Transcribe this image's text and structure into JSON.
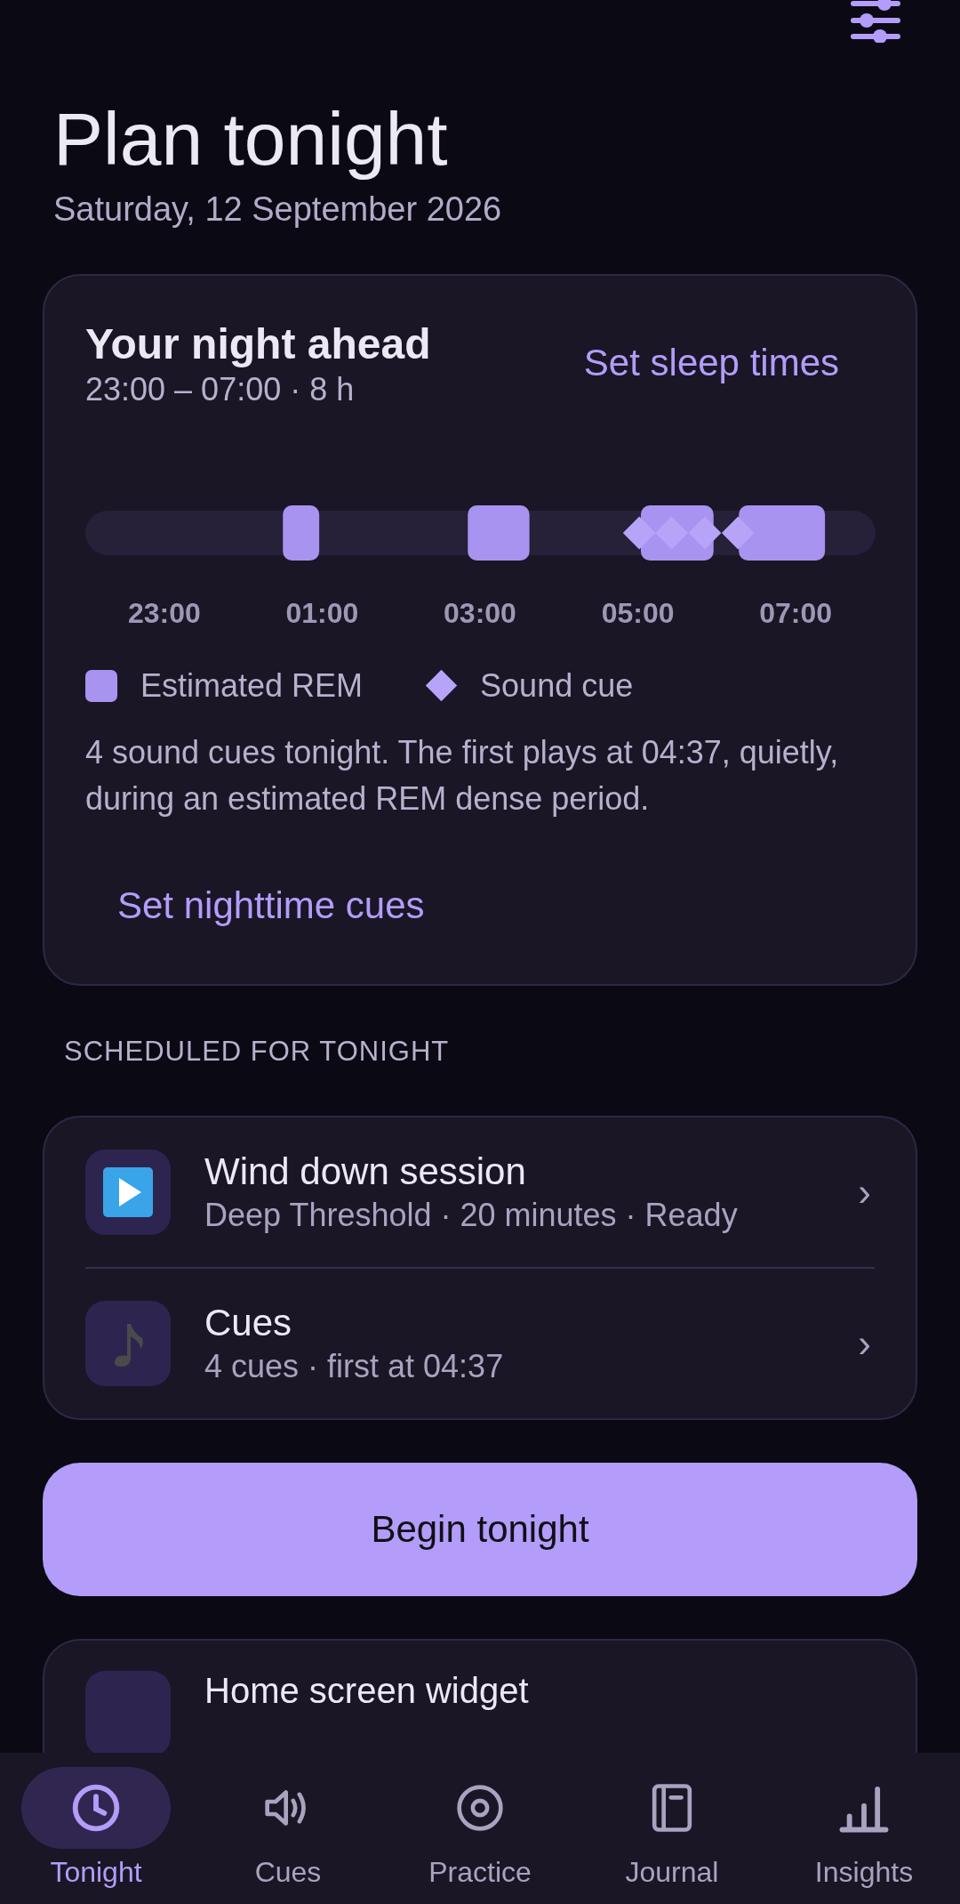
{
  "header": {
    "title": "Plan tonight",
    "date": "Saturday, 12 September 2026"
  },
  "night_card": {
    "title": "Your night ahead",
    "time_range": "23:00 – 07:00 · 8 h",
    "action": "Set sleep times",
    "time_labels": [
      "23:00",
      "01:00",
      "03:00",
      "05:00",
      "07:00"
    ],
    "legend": [
      {
        "kind": "rem",
        "label": "Estimated REM"
      },
      {
        "kind": "cue",
        "label": "Sound cue"
      }
    ],
    "summary": "4 sound cues tonight. The first plays at 04:37, quietly, during an estimated REM dense period.",
    "cues_button": "Set nighttime cues"
  },
  "section_title": "SCHEDULED FOR TONIGHT",
  "scheduled": [
    {
      "kind": "session",
      "title": "Wind down session",
      "subtitle": "Deep Threshold · 20 minutes · Ready",
      "chevron": "›"
    },
    {
      "kind": "cues",
      "title": "Cues",
      "subtitle": "4 cues · first at 04:37",
      "chevron": "›"
    }
  ],
  "begin_button": "Begin tonight",
  "widget_card": {
    "title": "Home screen widget"
  },
  "nav": [
    {
      "kind": "clock",
      "label": "Tonight",
      "selected": true
    },
    {
      "kind": "speaker",
      "label": "Cues",
      "selected": false
    },
    {
      "kind": "target",
      "label": "Practice",
      "selected": false
    },
    {
      "kind": "journal",
      "label": "Journal",
      "selected": false
    },
    {
      "kind": "chart",
      "label": "Insights",
      "selected": false
    }
  ]
}
